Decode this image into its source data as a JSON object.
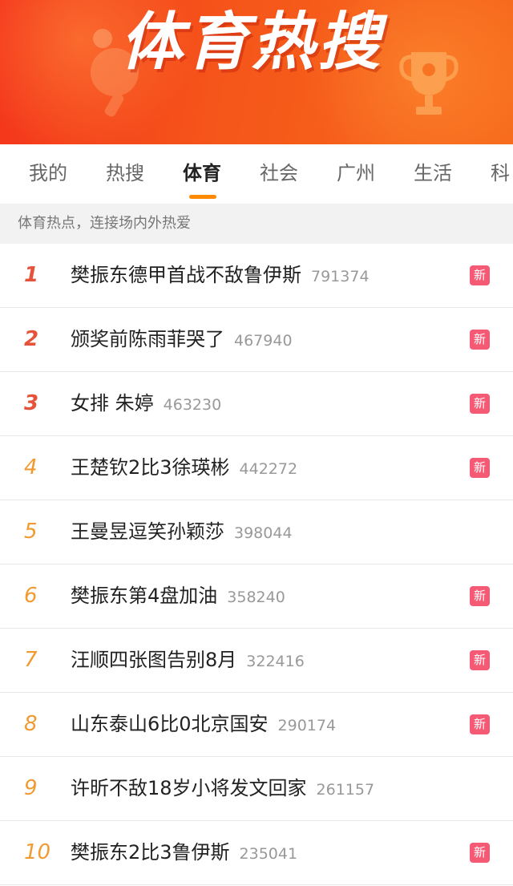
{
  "banner": {
    "title": "体育热搜"
  },
  "tabs": [
    {
      "label": "我的"
    },
    {
      "label": "热搜"
    },
    {
      "label": "体育"
    },
    {
      "label": "社会"
    },
    {
      "label": "广州"
    },
    {
      "label": "生活"
    },
    {
      "label": "科"
    }
  ],
  "active_tab": "体育",
  "subheader": "体育热点，连接场内外热爱",
  "badge_label": "新",
  "items": [
    {
      "rank": "1",
      "title": "樊振东德甲首战不敌鲁伊斯",
      "count": "791374",
      "is_new": true
    },
    {
      "rank": "2",
      "title": "颁奖前陈雨菲哭了",
      "count": "467940",
      "is_new": true
    },
    {
      "rank": "3",
      "title": "女排 朱婷",
      "count": "463230",
      "is_new": true
    },
    {
      "rank": "4",
      "title": "王楚钦2比3徐瑛彬",
      "count": "442272",
      "is_new": true
    },
    {
      "rank": "5",
      "title": "王曼昱逗笑孙颖莎",
      "count": "398044",
      "is_new": false
    },
    {
      "rank": "6",
      "title": "樊振东第4盘加油",
      "count": "358240",
      "is_new": true
    },
    {
      "rank": "7",
      "title": "汪顺四张图告别8月",
      "count": "322416",
      "is_new": true
    },
    {
      "rank": "8",
      "title": "山东泰山6比0北京国安",
      "count": "290174",
      "is_new": true
    },
    {
      "rank": "9",
      "title": "许昕不敌18岁小将发文回家",
      "count": "261157",
      "is_new": false
    },
    {
      "rank": "10",
      "title": "樊振东2比3鲁伊斯",
      "count": "235041",
      "is_new": true
    }
  ],
  "colors": {
    "banner": "#f5461b",
    "rank_top3": "#e5533b",
    "rank_rest": "#f19a30",
    "tab_indicator": "#ff8a00",
    "new_badge": "#f55a75"
  }
}
